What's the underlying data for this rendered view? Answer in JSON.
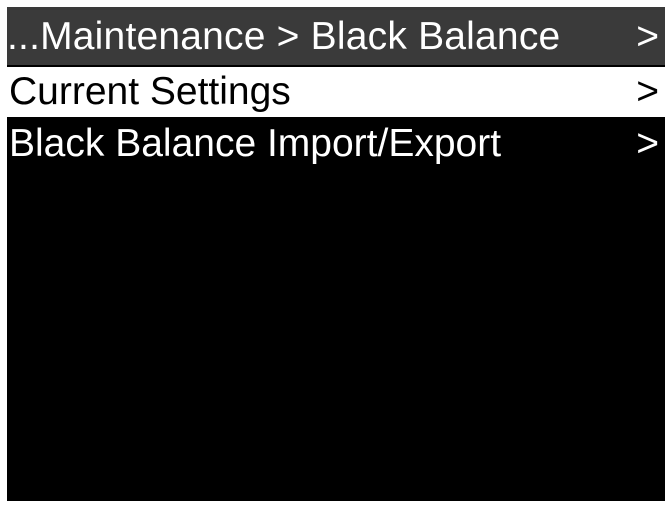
{
  "header": {
    "breadcrumb": "...Maintenance > Black Balance",
    "arrow": ">"
  },
  "menu": {
    "items": [
      {
        "label": "Current Settings",
        "arrow": ">",
        "selected": true
      },
      {
        "label": "Black Balance Import/Export",
        "arrow": ">",
        "selected": false
      }
    ]
  },
  "colors": {
    "background": "#000000",
    "header_bg": "#3a3a3a",
    "selected_bg": "#ffffff",
    "text": "#ffffff",
    "selected_text": "#000000"
  }
}
